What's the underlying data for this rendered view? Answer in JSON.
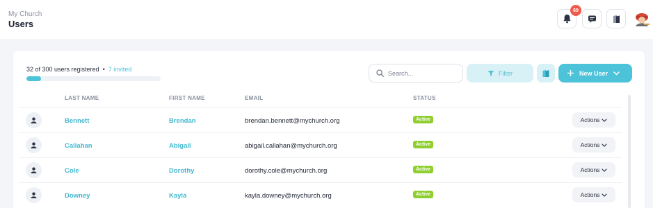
{
  "header": {
    "breadcrumb": "My Church",
    "title": "Users",
    "notifications_count": "69",
    "icons": [
      "bell-icon",
      "chat-icon",
      "book-icon",
      "user-avatar"
    ]
  },
  "registration": {
    "summary": "32 of 300 users registered",
    "separator": "•",
    "invited": "7 invited",
    "progress": 0.107
  },
  "toolbar": {
    "search_placeholder": "Search...",
    "filter_label": "Filter",
    "new_user_label": "New User"
  },
  "table": {
    "headers": {
      "last_name": "LAST NAME",
      "first_name": "FIRST NAME",
      "email": "EMAIL",
      "status": "STATUS"
    },
    "rows": [
      {
        "last": "Bennett",
        "first": "Brendan",
        "email": "brendan.bennett@mychurch.org",
        "status": "Active",
        "action": "Actions"
      },
      {
        "last": "Callahan",
        "first": "Abigail",
        "email": "abigail.callahan@mychurch.org",
        "status": "Active",
        "action": "Actions"
      },
      {
        "last": "Cole",
        "first": "Dorothy",
        "email": "dorothy.cole@mychurch.org",
        "status": "Active",
        "action": "Actions"
      },
      {
        "last": "Downey",
        "first": "Kayla",
        "email": "kayla.downey@mychurch.org",
        "status": "Active",
        "action": "Actions"
      }
    ]
  },
  "colors": {
    "accent": "#4cc3d8",
    "accent_light": "#d7f1f6",
    "status_active": "#8fcf2e",
    "badge": "#f05a4a"
  }
}
